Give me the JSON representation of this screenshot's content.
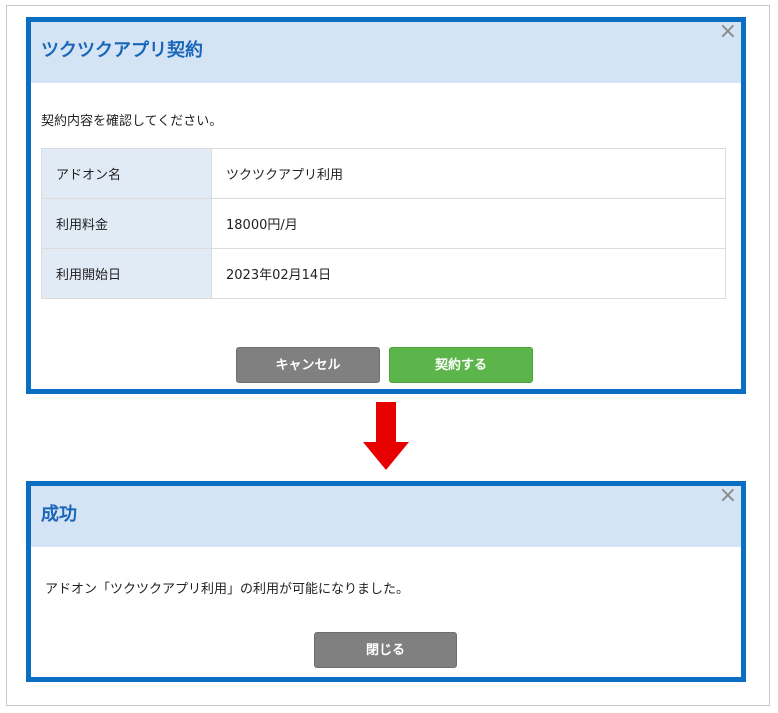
{
  "contract_dialog": {
    "title": "ツクツクアプリ契約",
    "close_glyph": "×",
    "message": "契約内容を確認してください。",
    "rows": [
      {
        "label": "アドオン名",
        "value": "ツクツクアプリ利用"
      },
      {
        "label": "利用料金",
        "value": "18000円/月"
      },
      {
        "label": "利用開始日",
        "value": "2023年02月14日"
      }
    ],
    "cancel_label": "キャンセル",
    "confirm_label": "契約する"
  },
  "success_dialog": {
    "title": "成功",
    "close_glyph": "×",
    "message": "アドオン「ツクツクアプリ利用」の利用が可能になりました。",
    "close_label": "閉じる"
  },
  "colors": {
    "border": "#0a6fc2",
    "header_bg": "#d4e4f5",
    "arrow": "#e60000",
    "confirm": "#5cb54a",
    "cancel": "#808080"
  },
  "icons": {
    "flow_arrow": "down-arrow-icon",
    "close": "close-icon"
  }
}
